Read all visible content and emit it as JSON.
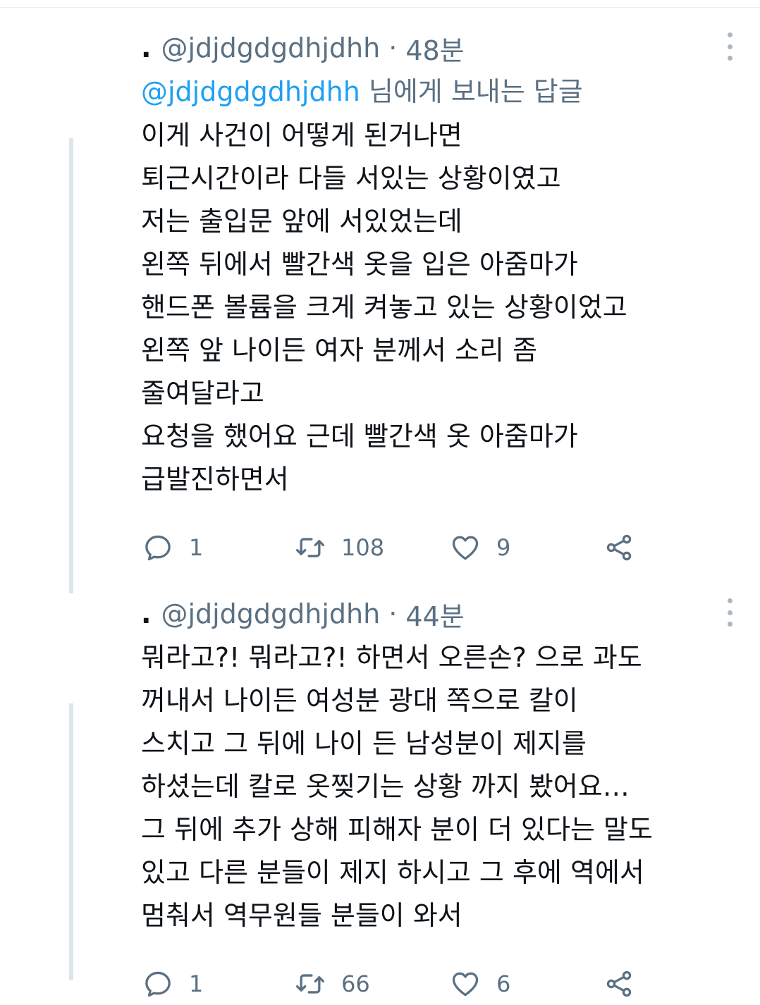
{
  "tweets": [
    {
      "display_name": ".",
      "handle": "@jdjdgdgdhjdhh",
      "separator": "·",
      "time": "48분",
      "reply_to": {
        "handle": "@jdjdgdgdhjdhh",
        "suffix": " 님에게 보내는 답글"
      },
      "text": "이게 사건이 어떻게 된거나면\n퇴근시간이라 다들 서있는 상황이였고\n저는 출입문 앞에 서있었는데\n왼쪽 뒤에서 빨간색 옷을 입은 아줌마가\n핸드폰 볼륨을 크게 켜놓고 있는 상황이었고\n왼쪽 앞 나이든 여자 분께서 소리 좀\n줄여달라고\n요청을 했어요 근데 빨간색 옷 아줌마가\n급발진하면서",
      "actions": {
        "replies": "1",
        "retweets": "108",
        "likes": "9"
      }
    },
    {
      "display_name": ".",
      "handle": "@jdjdgdgdhjdhh",
      "separator": "·",
      "time": "44분",
      "text": "뭐라고?! 뭐라고?! 하면서 오른손? 으로 과도\n꺼내서 나이든 여성분 광대 쪽으로 칼이\n스치고 그 뒤에 나이 든 남성분이 제지를\n하셨는데 칼로 옷찢기는 상황 까지 봤어요…\n그 뒤에 추가 상해 피해자 분이 더 있다는 말도\n있고 다른 분들이 제지 하시고 그 후에 역에서\n멈춰서 역무원들 분들이 와서",
      "actions": {
        "replies": "1",
        "retweets": "66",
        "likes": "6"
      }
    }
  ],
  "icons": {
    "reply": "reply-icon",
    "retweet": "retweet-icon",
    "like": "heart-icon",
    "share": "share-icon",
    "more": "more-icon"
  },
  "colors": {
    "link": "#1da1f2",
    "secondary": "#5b7083",
    "text": "#0f1419",
    "thread_line": "#dfe6ea"
  }
}
